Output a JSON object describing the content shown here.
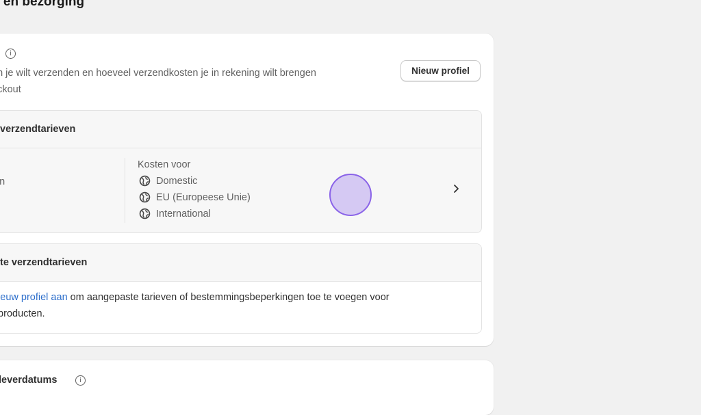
{
  "page": {
    "title": "g en bezorging"
  },
  "shipping_card": {
    "description": "en je wilt verzenden en hoeveel verzendkosten je in rekening wilt brengen eckout",
    "description_line1": "en je wilt verzenden en hoeveel verzendkosten je in rekening wilt brengen",
    "description_line2": "eckout",
    "new_profile_button": "Nieuw profiel"
  },
  "general_rates": {
    "heading": "verzendtarieven",
    "left_label": "en",
    "costs_label": "Kosten voor",
    "zones": [
      {
        "label": "Domestic",
        "icon": "globe-icon"
      },
      {
        "label": "EU (Europeese Unie)",
        "icon": "globe-icon"
      },
      {
        "label": "International",
        "icon": "globe-icon"
      }
    ]
  },
  "custom_rates": {
    "heading": "te verzendtarieven",
    "link_text": "nieuw profiel aan",
    "text_after_link": " om aangepaste tarieven of bestemmingsbeperkingen toe te voegen voor",
    "line2": "f producten."
  },
  "delivery_card": {
    "title": "leverdatums"
  },
  "colors": {
    "link": "#2c6ecb",
    "cursor": "#8a63e8",
    "background": "#f1f1f1"
  }
}
